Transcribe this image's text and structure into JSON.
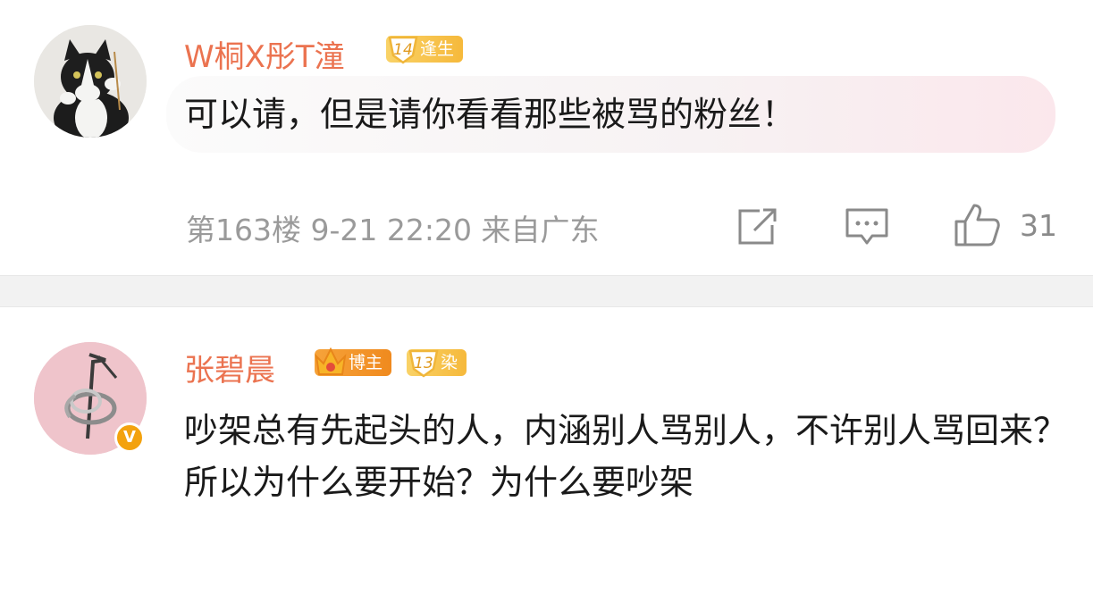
{
  "comments": [
    {
      "username": "W桐X彤T潼",
      "level": "14",
      "badge_label": "逢生",
      "content": "可以请，但是请你看看那些被骂的粉丝！",
      "meta": "第163楼 9-21 22:20 来自广东",
      "likes": "31",
      "icons": [
        "share-icon",
        "comment-icon",
        "like-icon"
      ]
    },
    {
      "username": "张碧晨",
      "verified_badge": "V",
      "host_label": "博主",
      "level": "13",
      "badge_label": "染",
      "content": "吵架总有先起头的人，内涵别人骂别人，不许别人骂回来？所以为什么要开始？为什么要吵架"
    }
  ],
  "colors": {
    "username": "#eb7350",
    "meta": "#9a9a9a",
    "divider": "#f2f2f2",
    "verified": "#f3a20e"
  }
}
